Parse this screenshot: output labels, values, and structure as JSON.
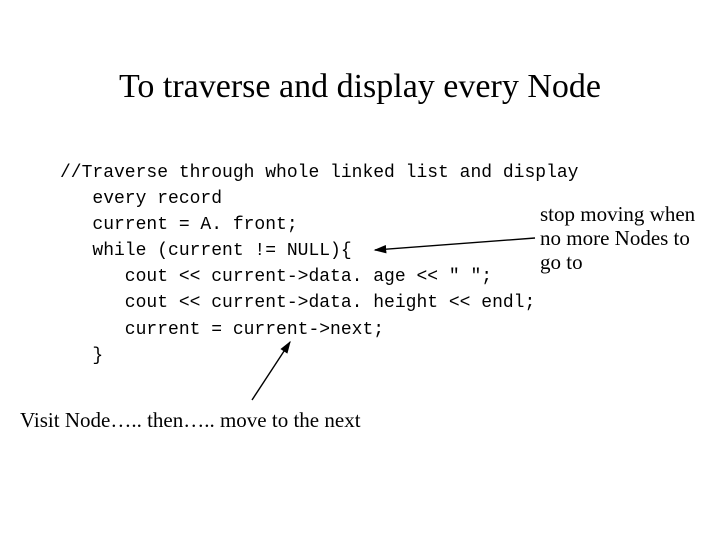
{
  "title": "To traverse and display every Node",
  "code": {
    "l1": "//Traverse through whole linked list and display",
    "l2": "   every record",
    "l3": "   current = A. front;",
    "l4": "   while (current != NULL){",
    "l5": "      cout << current->data. age << \" \";",
    "l6": "      cout << current->data. height << endl;",
    "l7": "      current = current->next;",
    "l8": "   }"
  },
  "annotations": {
    "right": "stop moving when no more Nodes to go to",
    "bottom": "Visit Node….. then….. move to the next"
  }
}
